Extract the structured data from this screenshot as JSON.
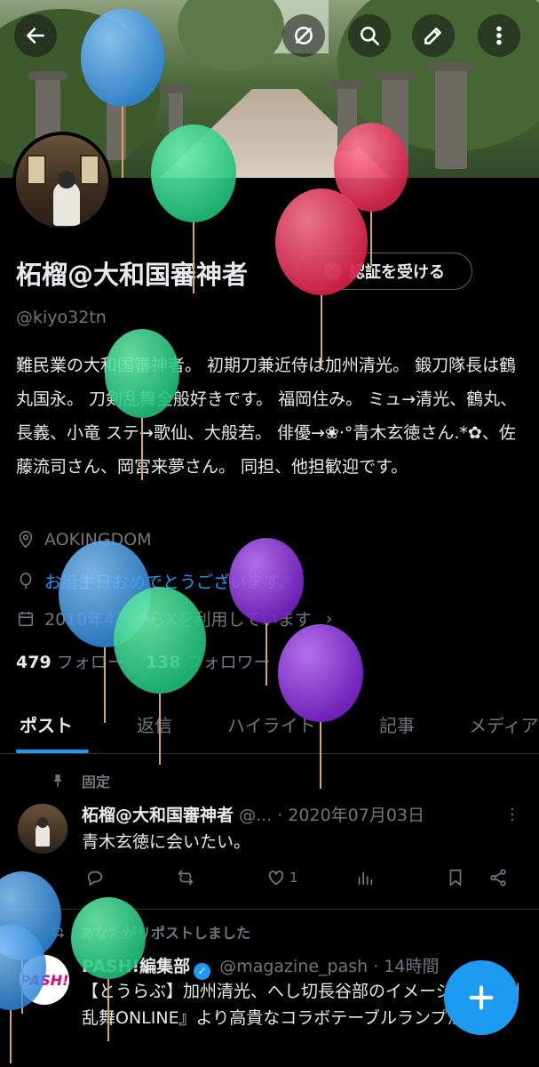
{
  "header": {
    "back_icon": "arrow-left-icon",
    "actions": [
      "block-icon",
      "search-icon",
      "edit-icon",
      "more-vertical-icon"
    ]
  },
  "profile": {
    "name": "柘榴@大和国審神者",
    "verify_button": "認証を受ける",
    "handle": "@kiyo32tn",
    "bio": "難民業の大和国審神者。 初期刀兼近侍は加州清光。 鍛刀隊長は鶴丸国永。 刀剣乱舞全般好きです。 福岡住み。 ミュ→清光、鶴丸、長義、小竜 ステ→歌仙、大般若。 俳優→❀·°青木玄徳さん.*✿、佐藤流司さん、岡宮来夢さん。 同担、他担歓迎です。",
    "location": "AOKINGDOM",
    "birthday_link": "お誕生日おめでとうございます。",
    "joined": "2010年4月からXを利用しています",
    "following_count": "479",
    "following_label": "フォロー",
    "followers_count": "138",
    "followers_label": "フォロワー"
  },
  "tabs": [
    "ポスト",
    "返信",
    "ハイライト",
    "記事",
    "メディア"
  ],
  "pinned_tweet": {
    "pin_label": "固定",
    "author": "柘榴@大和国審神者",
    "handle": "@...",
    "date": "· 2020年07月03日",
    "text": "青木玄徳に会いたい。",
    "like_count": "1"
  },
  "retweet": {
    "rt_label": "あなたがリポストしました",
    "author": "PASH!編集部",
    "handle": "@magazine_pash",
    "time": "· 14時間",
    "avatar_text": "PASH!",
    "text": "【とうらぶ】加州清光、へし切長谷部のイメージ！『刀剣乱舞ONLINE』より高貴なコラボテーブルランプが登場"
  },
  "colors": {
    "accent": "#1d9bf0",
    "muted": "#71767b",
    "text": "#e7e9ea",
    "background": "#000000"
  },
  "fab_icon": "plus-icon"
}
